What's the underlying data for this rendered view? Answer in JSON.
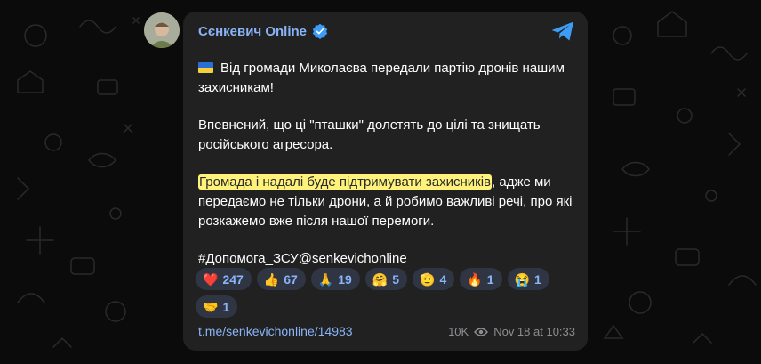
{
  "channel": {
    "name": "Сєнкевич Online",
    "verified_icon": "verified-badge-icon"
  },
  "post": {
    "p1": "Від громади Миколаєва передали партію дронів нашим захисникам!",
    "p2": "Впевнений, що ці \"пташки\" долетять до цілі та знищать російського агресора.",
    "p3_highlight": "Громада і надалі буде підтримувати захисників",
    "p3_rest": ", адже ми передаємо не тільки дрони, а й робимо важливі речі, про які розкажемо вже після нашої перемоги.",
    "hashtags": "#Допомога_ЗСУ@senkevichonline"
  },
  "reactions": [
    {
      "emoji": "❤️",
      "icon": "red-heart-icon",
      "count": "247"
    },
    {
      "emoji": "👍",
      "icon": "thumbs-up-icon",
      "count": "67"
    },
    {
      "emoji": "🙏",
      "icon": "folded-hands-icon",
      "count": "19"
    },
    {
      "emoji": "🤗",
      "icon": "hugging-face-icon",
      "count": "5"
    },
    {
      "emoji": "🫡",
      "icon": "saluting-face-icon",
      "count": "4"
    },
    {
      "emoji": "🔥",
      "icon": "fire-icon",
      "count": "1"
    },
    {
      "emoji": "😭",
      "icon": "crying-face-icon",
      "count": "1"
    },
    {
      "emoji": "🤝",
      "icon": "handshake-icon",
      "count": "1"
    }
  ],
  "footer": {
    "link": "t.me/senkevichonline/14983",
    "views": "10K",
    "datetime": "Nov 18 at 10:33"
  },
  "colors": {
    "background": "#0b0b0c",
    "bubble": "#212121",
    "accent": "#8ab4f8",
    "highlight": "#fff27a",
    "reaction_bg": "#2f3543"
  }
}
